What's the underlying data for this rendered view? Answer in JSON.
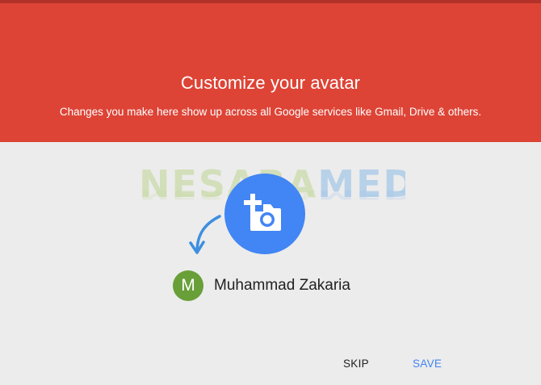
{
  "header": {
    "title": "Customize your avatar",
    "subtitle": "Changes you make here show up across all Google services like Gmail, Drive & others."
  },
  "watermark": {
    "left": "NESABA",
    "right": "MEDIA"
  },
  "avatar_picker": {
    "icon": "add-photo-icon"
  },
  "user": {
    "initial": "M",
    "name": "Muhammad Zakaria"
  },
  "actions": {
    "skip_label": "SKIP",
    "save_label": "SAVE"
  },
  "colors": {
    "header_bg": "#dd4436",
    "accent": "#4285f4",
    "avatar_bg": "#689f38",
    "content_bg": "#ececec"
  }
}
